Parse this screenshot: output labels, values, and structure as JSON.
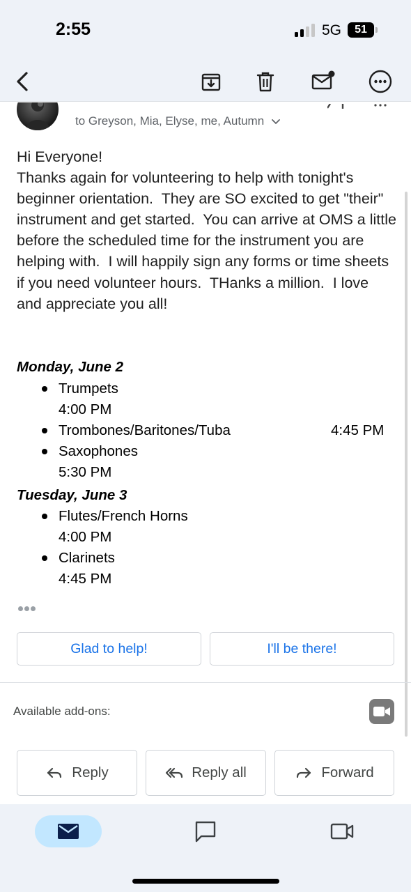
{
  "status_bar": {
    "time": "2:55",
    "network": "5G",
    "battery": "51"
  },
  "toolbar": {
    "back_icon": "chevron-left-icon",
    "archive_icon": "archive-icon",
    "delete_icon": "trash-icon",
    "mark_unread_icon": "mail-unread-icon",
    "more_icon": "more-horizontal-icon"
  },
  "email": {
    "recipients": "to Greyson, Mia, Elyse, me, Autumn",
    "body": "Hi Everyone!\nThanks again for volunteering to help with tonight's beginner orientation.  They are SO excited to get \"their\" instrument and get started.  You can arrive at OMS a little before the scheduled time for the instrument you are helping with.  I will happily sign any forms or time sheets if you need volunteer hours.  THanks a million.  I love and appreciate you all!",
    "schedule": [
      {
        "day": "Monday, June 2",
        "items": [
          {
            "instrument": "Trumpets",
            "time": "4:00 PM"
          },
          {
            "instrument": "Trombones/Baritones/Tuba",
            "time": "4:45 PM"
          },
          {
            "instrument": "Saxophones",
            "time": "5:30 PM"
          }
        ]
      },
      {
        "day": "Tuesday, June 3",
        "items": [
          {
            "instrument": "Flutes/French Horns",
            "time": "4:00 PM"
          },
          {
            "instrument": "Clarinets",
            "time": "4:45 PM"
          }
        ]
      }
    ]
  },
  "smart_replies": [
    "Glad to help!",
    "I'll be there!"
  ],
  "addons": {
    "label": "Available add-ons:",
    "icon": "video-camera-icon"
  },
  "actions": {
    "reply": "Reply",
    "reply_all": "Reply all",
    "forward": "Forward"
  },
  "bottom_nav": {
    "mail_icon": "mail-icon",
    "chat_icon": "chat-icon",
    "meet_icon": "video-icon"
  },
  "colors": {
    "accent": "#1a73e8",
    "chrome_bg": "#eef2f8",
    "active_pill": "#c2e7ff"
  }
}
